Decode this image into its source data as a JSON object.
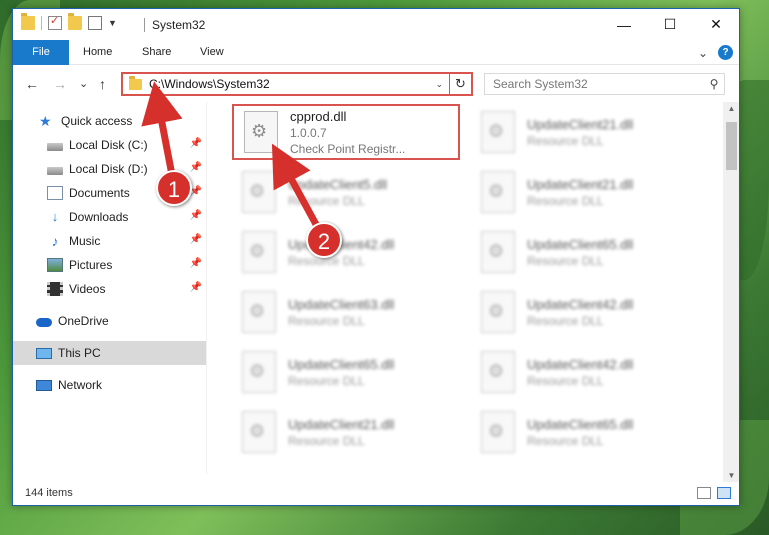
{
  "window": {
    "title": "System32",
    "minimize": "—",
    "maximize": "☐",
    "close": "✕"
  },
  "ribbon": {
    "tabs": [
      "File",
      "Home",
      "Share",
      "View"
    ],
    "expand": "⌄",
    "help": "?"
  },
  "nav": {
    "back": "←",
    "forward": "→",
    "recent": "⌄",
    "up": "↑",
    "address": "C:\\Windows\\System32",
    "refresh": "↻",
    "search_placeholder": "Search System32"
  },
  "sidebar": {
    "items": [
      {
        "label": "Quick access",
        "icon": "star-icon",
        "pinned": false
      },
      {
        "label": "Local Disk (C:)",
        "icon": "drive-icon",
        "pinned": true
      },
      {
        "label": "Local Disk (D:)",
        "icon": "drive-icon",
        "pinned": true
      },
      {
        "label": "Documents",
        "icon": "documents-icon",
        "pinned": true
      },
      {
        "label": "Downloads",
        "icon": "download-icon",
        "pinned": true
      },
      {
        "label": "Music",
        "icon": "music-icon",
        "pinned": true
      },
      {
        "label": "Pictures",
        "icon": "pictures-icon",
        "pinned": true
      },
      {
        "label": "Videos",
        "icon": "videos-icon",
        "pinned": true
      },
      {
        "label": "OneDrive",
        "icon": "cloud-icon",
        "pinned": false
      },
      {
        "label": "This PC",
        "icon": "computer-icon",
        "pinned": false,
        "active": true
      },
      {
        "label": "Network",
        "icon": "network-icon",
        "pinned": false
      }
    ]
  },
  "files": [
    {
      "name": "cpprod.dll",
      "line2": "1.0.0.7",
      "line3": "Check Point Registr...",
      "highlight": true
    },
    {
      "name": "UpdateClient21.dll",
      "line2": "Resource DLL"
    },
    {
      "name": "UpdateClient5.dll",
      "line2": "Resource DLL"
    },
    {
      "name": "UpdateClient21.dll",
      "line2": "Resource DLL"
    },
    {
      "name": "UpdateClient42.dll",
      "line2": "Resource DLL"
    },
    {
      "name": "UpdateClient65.dll",
      "line2": "Resource DLL"
    },
    {
      "name": "UpdateClient63.dll",
      "line2": "Resource DLL"
    },
    {
      "name": "UpdateClient42.dll",
      "line2": "Resource DLL"
    },
    {
      "name": "UpdateClient65.dll",
      "line2": "Resource DLL"
    },
    {
      "name": "UpdateClient42.dll",
      "line2": "Resource DLL"
    },
    {
      "name": "UpdateClient21.dll",
      "line2": "Resource DLL"
    },
    {
      "name": "UpdateClient65.dll",
      "line2": "Resource DLL"
    }
  ],
  "status": {
    "count": "144 items"
  },
  "callouts": [
    "1",
    "2"
  ],
  "colors": {
    "accent": "#1979ca",
    "highlight_border": "#d9534f",
    "callout": "#d6302c"
  }
}
